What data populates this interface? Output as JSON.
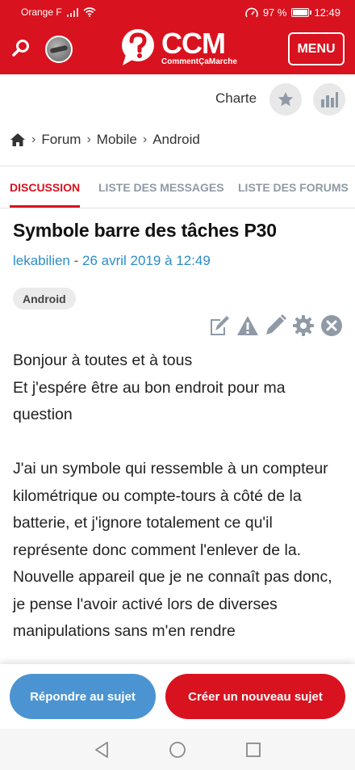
{
  "status_bar": {
    "carrier": "Orange F",
    "battery_pct": "97 %",
    "battery_level": 0.97,
    "time": "12:49",
    "icons": [
      "signal-icon",
      "wifi-icon",
      "speedometer-icon",
      "battery-icon"
    ]
  },
  "header": {
    "logo_main": "CCM",
    "logo_sub": "CommentÇaMarche",
    "menu_label": "MENU",
    "brand_color": "#d9121f",
    "icons": [
      "search-icon",
      "avatar",
      "logo-icon"
    ]
  },
  "toolbar": {
    "charte_label": "Charte",
    "icons": [
      "star-icon",
      "stats-icon"
    ]
  },
  "breadcrumb": {
    "home_icon": "home-icon",
    "items": [
      "Forum",
      "Mobile",
      "Android"
    ]
  },
  "tabs": [
    {
      "label": "DISCUSSION",
      "active": true
    },
    {
      "label": "LISTE DES MESSAGES",
      "active": false
    },
    {
      "label": "LISTE DES FORUMS",
      "active": false
    }
  ],
  "post": {
    "title": "Symbole barre des tâches P30",
    "author": "lekabilien",
    "separator": "-",
    "date": "26 avril 2019 à 12:49",
    "tag": "Android",
    "tools": [
      "signature-icon",
      "warning-icon",
      "edit-icon",
      "gear-icon",
      "close-icon"
    ],
    "body": [
      "Bonjour à toutes et à tous",
      "Et j'espére être au bon endroit pour ma question",
      "",
      "J'ai un symbole qui ressemble à un compteur kilométrique ou compte-tours à côté de la batterie, et j'ignore totalement ce qu'il représente donc comment l'enlever de la.",
      "Nouvelle appareil que je ne connaît pas donc, je pense l'avoir activé lors de diverses manipulations sans m'en rendre"
    ]
  },
  "actions": {
    "reply_label": "Répondre au sujet",
    "new_label": "Créer un nouveau sujet",
    "reply_color": "#4b94d1",
    "new_color": "#d9121f"
  },
  "nav": {
    "icons": [
      "back-icon",
      "home-circle-icon",
      "recents-icon"
    ]
  }
}
